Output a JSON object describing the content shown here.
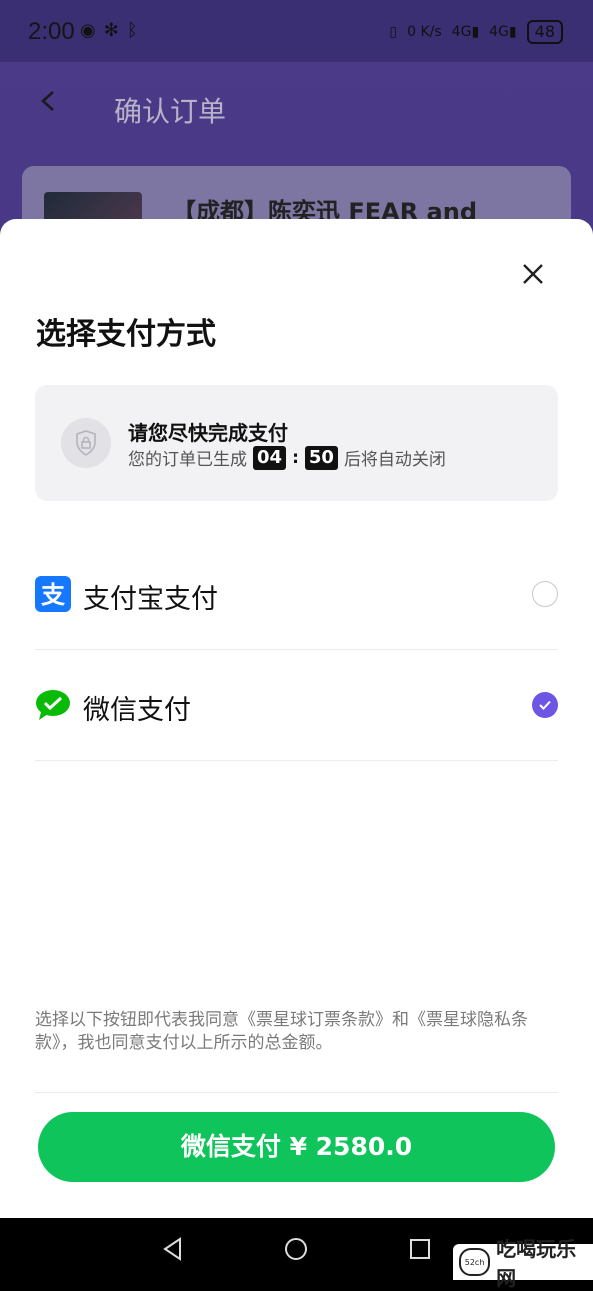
{
  "status_bar": {
    "time": "2:00",
    "battery": "48",
    "net_speed_top": "0",
    "net_speed_unit": "K/s",
    "signal_1": "4G",
    "signal_2": "4G"
  },
  "background_page": {
    "title": "确认订单",
    "card_title": "【成都】陈奕迅 FEAR and"
  },
  "sheet": {
    "title": "选择支付方式",
    "notice": {
      "title": "请您尽快完成支付",
      "prefix": "您的订单已生成",
      "minutes": "04",
      "seconds": "50",
      "suffix": "后将自动关闭"
    },
    "methods": [
      {
        "label": "支付宝支付",
        "icon": "alipay-icon",
        "selected": false
      },
      {
        "label": "微信支付",
        "icon": "wechat-icon",
        "selected": true
      }
    ],
    "terms": "选择以下按钮即代表我同意《票星球订票条款》和《票星球隐私条款》，我也同意支付以上所示的总金额。",
    "pay_button": "微信支付 ¥ 2580.0"
  },
  "watermark": {
    "text": "吃喝玩乐网",
    "logo": "52ch"
  },
  "colors": {
    "accent": "#6d56e6",
    "pay_green": "#0fc45a",
    "alipay_blue": "#1677ff",
    "wechat_green": "#09bb07"
  }
}
